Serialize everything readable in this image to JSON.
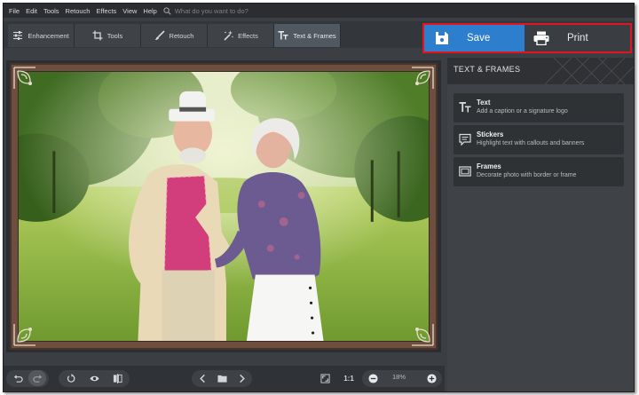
{
  "menu": {
    "items": [
      "File",
      "Edit",
      "Tools",
      "Retouch",
      "Effects",
      "View",
      "Help"
    ],
    "search_placeholder": "What do you want to do?"
  },
  "tabs": [
    {
      "label": "Enhancement",
      "icon": "sliders-icon"
    },
    {
      "label": "Tools",
      "icon": "crop-icon"
    },
    {
      "label": "Retouch",
      "icon": "brush-icon"
    },
    {
      "label": "Effects",
      "icon": "magic-wand-icon"
    },
    {
      "label": "Text & Frames",
      "icon": "text-icon",
      "active": true
    }
  ],
  "actions": {
    "save_label": "Save",
    "print_label": "Print",
    "highlight_color": "#e2141e",
    "save_color": "#2d7ecd"
  },
  "panel": {
    "title": "TEXT & FRAMES",
    "items": [
      {
        "title": "Text",
        "desc": "Add a caption or a signature logo",
        "icon": "text-icon"
      },
      {
        "title": "Stickers",
        "desc": "Highlight text with callouts and banners",
        "icon": "sticker-icon"
      },
      {
        "title": "Frames",
        "desc": "Decorate photo with border or frame",
        "icon": "frame-icon"
      }
    ]
  },
  "toolbar": {
    "zoom_ratio_label": "1:1",
    "zoom_value": "18%"
  },
  "colors": {
    "app_bg": "#3b3e43",
    "frame_wood": "#6e4f3f",
    "active_tab": "#505861"
  }
}
